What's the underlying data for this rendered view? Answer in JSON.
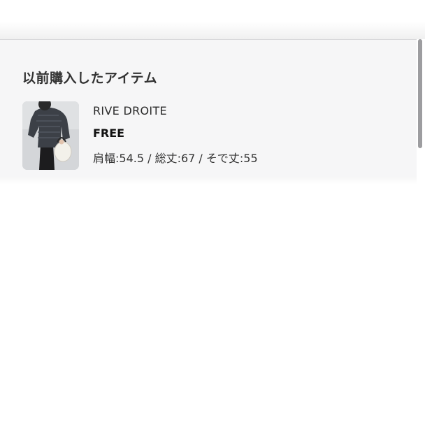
{
  "history": {
    "title": "以前購入したアイテム",
    "items": [
      {
        "brand": "RIVE DROITE",
        "size": "FREE",
        "measurements": "肩幅:54.5 / 総丈:67 / そで丈:55",
        "thumbnail": "product-photo-knit-top"
      }
    ]
  },
  "colors": {
    "panel_background": "#f6f6f7",
    "title_text": "#333333",
    "scrollbar": "#9d9da0"
  }
}
